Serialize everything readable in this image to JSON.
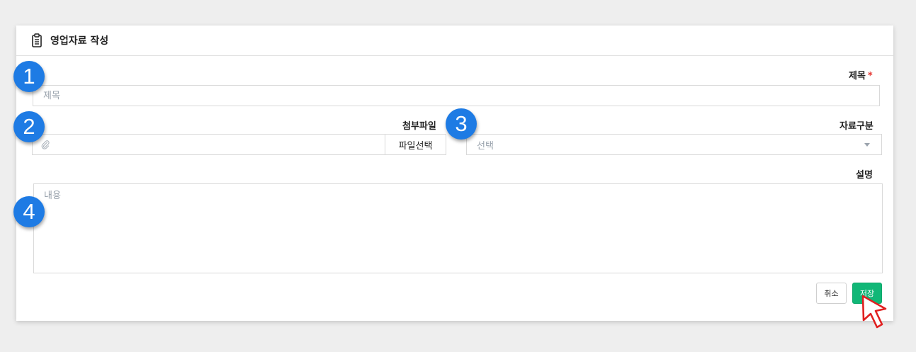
{
  "header": {
    "title": "영업자료 작성",
    "icon": "clipboard-icon"
  },
  "form": {
    "title": {
      "label": "제목",
      "required_mark": "*",
      "placeholder": "제목",
      "value": ""
    },
    "attachment": {
      "label": "첨부파일",
      "button_label": "파일선택",
      "icon": "paperclip-icon",
      "value": ""
    },
    "category": {
      "label": "자료구분",
      "selected": "선택",
      "icon": "chevron-down-icon"
    },
    "description": {
      "label": "설명",
      "placeholder": "내용",
      "value": ""
    }
  },
  "actions": {
    "cancel_label": "취소",
    "save_label": "저장"
  },
  "callouts": [
    "1",
    "2",
    "3",
    "4"
  ],
  "colors": {
    "accent": "#1e7be4",
    "save": "#11b777",
    "required": "#e53935"
  }
}
